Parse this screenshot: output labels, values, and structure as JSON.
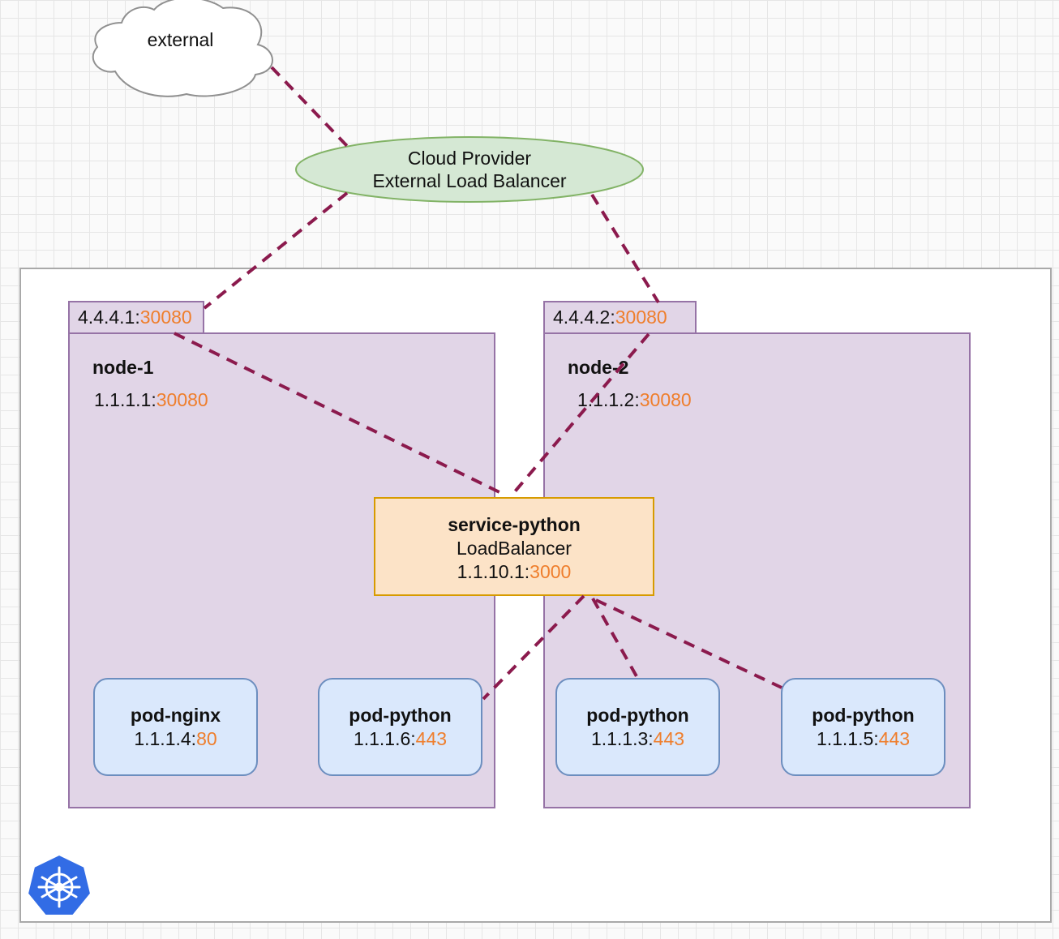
{
  "external": {
    "label": "external"
  },
  "load_balancer": {
    "line1": "Cloud Provider",
    "line2": "External Load Balancer"
  },
  "nodes": [
    {
      "tab_ip": "4.4.4.1:",
      "tab_port": "30080",
      "title": "node-1",
      "ip": "1.1.1.1:",
      "port": "30080"
    },
    {
      "tab_ip": "4.4.4.2:",
      "tab_port": "30080",
      "title": "node-2",
      "ip": "1.1.1.2:",
      "port": "30080"
    }
  ],
  "service": {
    "title": "service-python",
    "type": "LoadBalancer",
    "ip": "1.1.10.1:",
    "port": "3000"
  },
  "pods": [
    {
      "title": "pod-nginx",
      "ip": "1.1.1.4:",
      "port": "80"
    },
    {
      "title": "pod-python",
      "ip": "1.1.1.6:",
      "port": "443"
    },
    {
      "title": "pod-python",
      "ip": "1.1.1.3:",
      "port": "443"
    },
    {
      "title": "pod-python",
      "ip": "1.1.1.5:",
      "port": "443"
    }
  ],
  "colors": {
    "node_fill": "#e1d5e7",
    "node_stroke": "#9673a6",
    "pod_fill": "#dae8fc",
    "pod_stroke": "#6c8ebf",
    "service_fill": "#fce3c7",
    "service_stroke": "#d79b00",
    "lb_fill": "#d5e8d4",
    "lb_stroke": "#82b366",
    "port_text": "#ef7e2c",
    "edge": "#8b1a4d",
    "k8s_logo": "#326ce5"
  },
  "icons": {
    "logo": "kubernetes-logo-icon",
    "cloud": "cloud-shape"
  }
}
